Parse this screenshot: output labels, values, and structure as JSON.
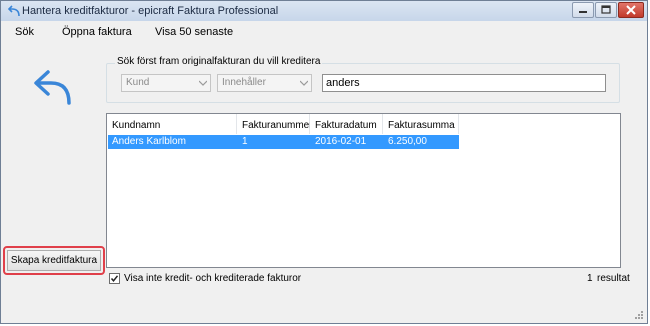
{
  "window": {
    "title": "Hantera kreditfakturor - epicraft Faktura Professional"
  },
  "menu": {
    "items": [
      "Sök",
      "Öppna faktura",
      "Visa 50 senaste"
    ]
  },
  "search": {
    "group_label": "Sök först fram originalfakturan du vill kreditera",
    "field_select": "Kund",
    "operator_select": "Innehåller",
    "query": "anders"
  },
  "results": {
    "columns": [
      "Kundnamn",
      "Fakturanummer",
      "Fakturadatum",
      "Fakturasumma"
    ],
    "rows": [
      {
        "kundnamn": "Anders Karlblom",
        "fakturanummer": "1",
        "fakturadatum": "2016-02-01",
        "fakturasumma": "6.250,00"
      }
    ],
    "selected_row_color": "#3399ff"
  },
  "footer": {
    "hide_credited_label": "Visa inte kredit- och krediterade fakturor",
    "hide_credited_checked": true,
    "result_count": "1",
    "result_label": "resultat"
  },
  "actions": {
    "create_credit_label": "Skapa kreditfaktura",
    "highlight_color": "#e0404a"
  },
  "icons": {
    "title_icon": "back-arrow-icon",
    "back": "back-arrow-icon",
    "checkbox": "checkmark-icon"
  }
}
